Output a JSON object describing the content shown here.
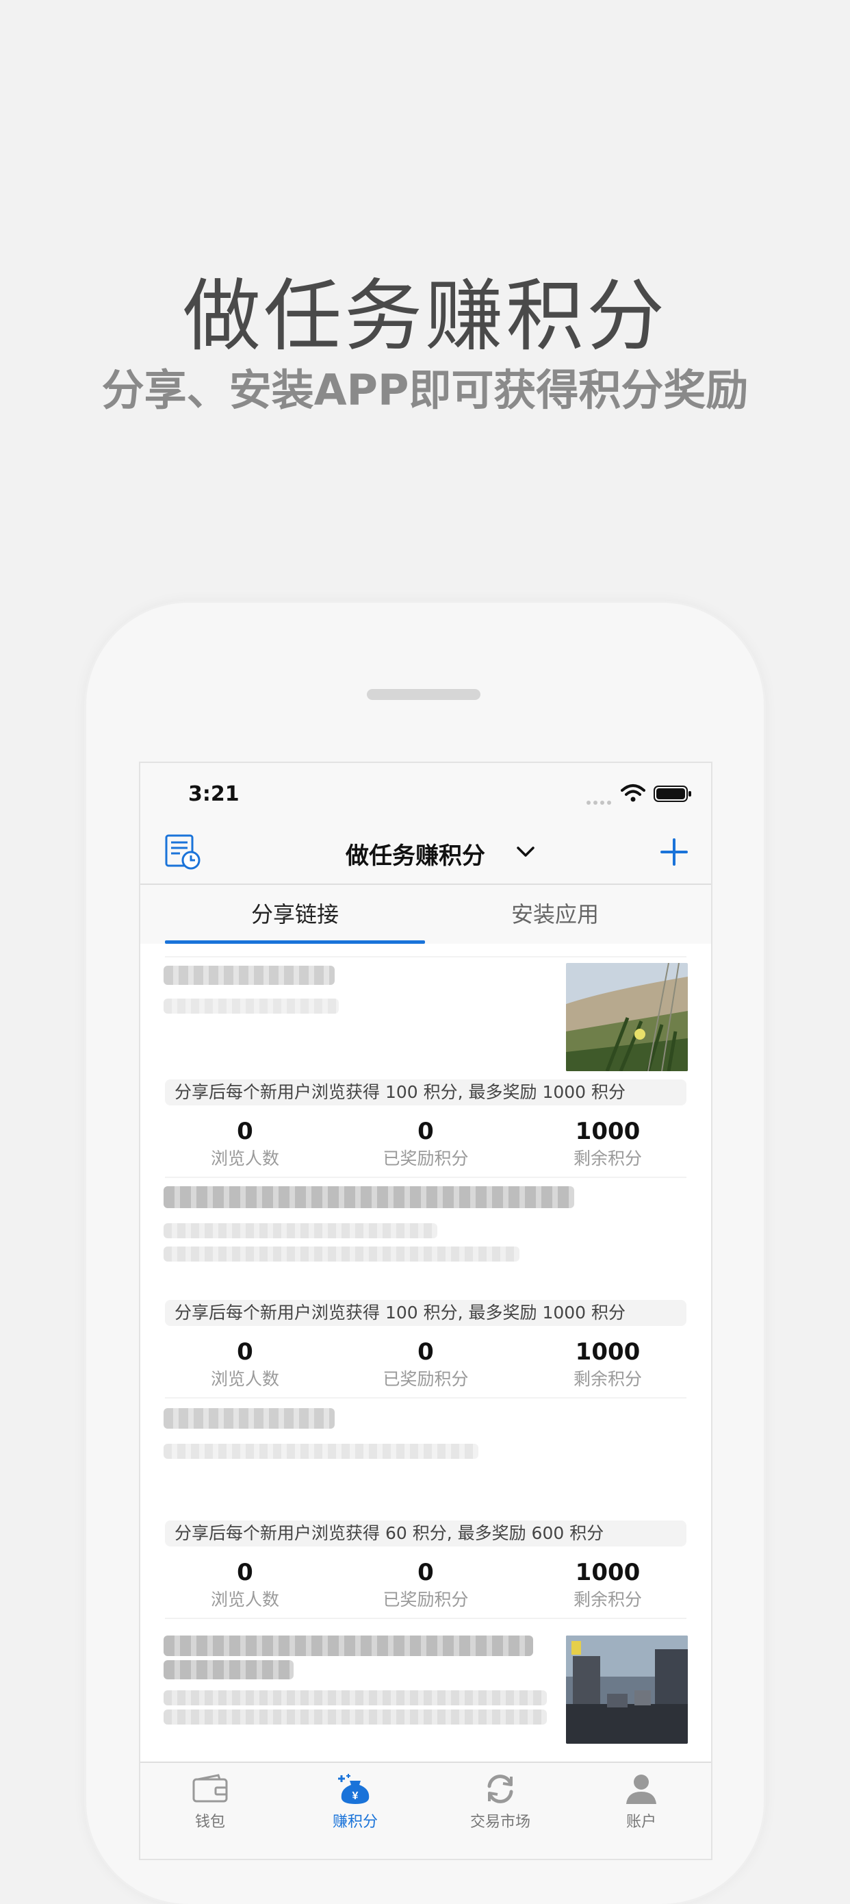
{
  "promo": {
    "title": "做任务赚积分",
    "subtitle": "分享、安装APP即可获得积分奖励"
  },
  "status_bar": {
    "time": "3:21"
  },
  "nav": {
    "title": "做任务赚积分"
  },
  "tabs": [
    {
      "label": "分享链接",
      "active": true
    },
    {
      "label": "安装应用",
      "active": false
    }
  ],
  "stat_labels": [
    "浏览人数",
    "已奖励积分",
    "剩余积分"
  ],
  "cards": [
    {
      "rule": "分享后每个新用户浏览获得 100 积分, 最多奖励 1000 积分",
      "views": "0",
      "rewarded": "0",
      "remaining": "1000",
      "thumbnail": "grass-flower-photo"
    },
    {
      "rule": "分享后每个新用户浏览获得 100 积分, 最多奖励 1000 积分",
      "views": "0",
      "rewarded": "0",
      "remaining": "1000",
      "thumbnail": null
    },
    {
      "rule": "分享后每个新用户浏览获得 60 积分, 最多奖励 600 积分",
      "views": "0",
      "rewarded": "0",
      "remaining": "1000",
      "thumbnail": null
    },
    {
      "thumbnail": "street-photo"
    }
  ],
  "tabbar": [
    {
      "label": "钱包",
      "icon": "wallet-icon",
      "active": false
    },
    {
      "label": "赚积分",
      "icon": "earn-points-icon",
      "active": true
    },
    {
      "label": "交易市场",
      "icon": "exchange-icon",
      "active": false
    },
    {
      "label": "账户",
      "icon": "account-icon",
      "active": false
    }
  ],
  "colors": {
    "accent": "#1a73d9",
    "background": "#f2f2f2"
  }
}
